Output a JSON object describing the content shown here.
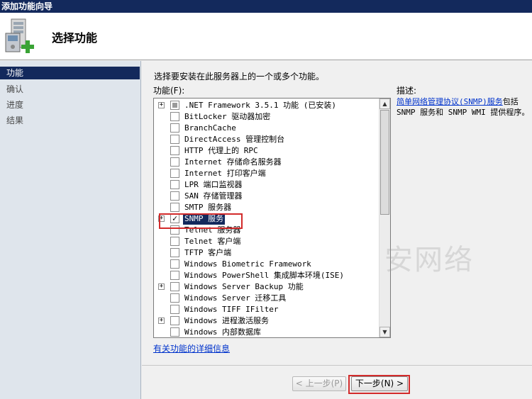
{
  "window": {
    "title": "添加功能向导"
  },
  "header": {
    "title": "选择功能"
  },
  "nav": [
    {
      "label": "功能",
      "active": true
    },
    {
      "label": "确认",
      "active": false
    },
    {
      "label": "进度",
      "active": false
    },
    {
      "label": "结果",
      "active": false
    }
  ],
  "main": {
    "instruction": "选择要安装在此服务器上的一个或多个功能。",
    "features_label": "功能(F):",
    "description_label": "描述:",
    "description_link": "简单网络管理协议(SNMP)服务",
    "description_text_1": "包括",
    "description_text_2": "SNMP 服务和 SNMP WMI 提供程序。",
    "more_info_link": "有关功能的详细信息",
    "watermark": "安网络"
  },
  "features": [
    {
      "label": ".NET Framework 3.5.1 功能  (已安装)",
      "expander": "+",
      "state": "partial"
    },
    {
      "label": "BitLocker 驱动器加密",
      "expander": "",
      "state": "unchecked"
    },
    {
      "label": "BranchCache",
      "expander": "",
      "state": "unchecked"
    },
    {
      "label": "DirectAccess 管理控制台",
      "expander": "",
      "state": "unchecked"
    },
    {
      "label": "HTTP 代理上的 RPC",
      "expander": "",
      "state": "unchecked"
    },
    {
      "label": "Internet 存储命名服务器",
      "expander": "",
      "state": "unchecked"
    },
    {
      "label": "Internet 打印客户端",
      "expander": "",
      "state": "unchecked"
    },
    {
      "label": "LPR 端口监视器",
      "expander": "",
      "state": "unchecked"
    },
    {
      "label": "SAN 存储管理器",
      "expander": "",
      "state": "unchecked"
    },
    {
      "label": "SMTP 服务器",
      "expander": "",
      "state": "unchecked"
    },
    {
      "label": "SNMP 服务",
      "expander": "+",
      "state": "checked",
      "selected": true
    },
    {
      "label": "Telnet 服务器",
      "expander": "",
      "state": "unchecked"
    },
    {
      "label": "Telnet 客户端",
      "expander": "",
      "state": "unchecked"
    },
    {
      "label": "TFTP 客户端",
      "expander": "",
      "state": "unchecked"
    },
    {
      "label": "Windows Biometric Framework",
      "expander": "",
      "state": "unchecked"
    },
    {
      "label": "Windows PowerShell 集成脚本环境(ISE)",
      "expander": "",
      "state": "unchecked"
    },
    {
      "label": "Windows Server Backup 功能",
      "expander": "+",
      "state": "unchecked"
    },
    {
      "label": "Windows Server 迁移工具",
      "expander": "",
      "state": "unchecked"
    },
    {
      "label": "Windows TIFF IFilter",
      "expander": "",
      "state": "unchecked"
    },
    {
      "label": "Windows 进程激活服务",
      "expander": "+",
      "state": "unchecked"
    },
    {
      "label": "Windows 内部数据库",
      "expander": "",
      "state": "unchecked"
    }
  ],
  "footer": {
    "prev_label": "< 上一步(P)",
    "next_label": "下一步(N) >"
  }
}
